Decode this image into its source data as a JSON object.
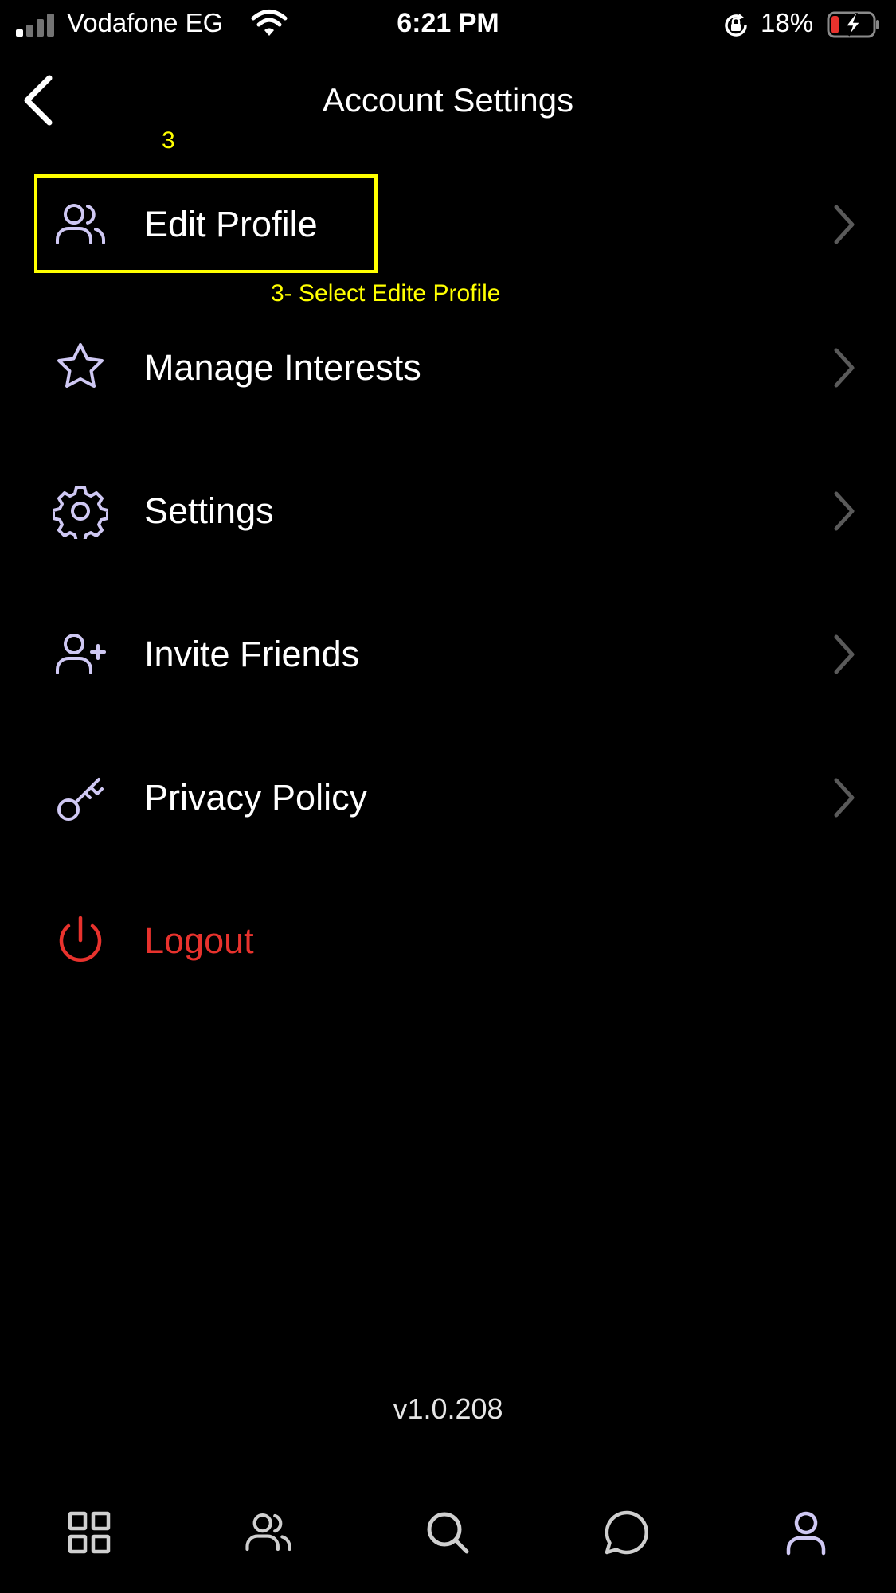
{
  "status_bar": {
    "carrier": "Vodafone EG",
    "time": "6:21 PM",
    "battery_percent": "18%",
    "battery_level": 0.18
  },
  "nav": {
    "title": "Account Settings",
    "back_icon": "chevron-left-icon"
  },
  "annotation": {
    "step_number": "3",
    "caption": "3- Select Edite Profile",
    "color": "#ffff00"
  },
  "menu": {
    "items": [
      {
        "label": "Edit Profile",
        "icon": "users-icon"
      },
      {
        "label": "Manage Interests",
        "icon": "star-icon"
      },
      {
        "label": "Settings",
        "icon": "gear-icon"
      },
      {
        "label": "Invite Friends",
        "icon": "user-plus-icon"
      },
      {
        "label": "Privacy Policy",
        "icon": "key-icon"
      },
      {
        "label": "Logout",
        "icon": "power-icon"
      }
    ]
  },
  "version": "v1.0.208",
  "tab_bar": {
    "tabs": [
      {
        "icon": "grid-icon"
      },
      {
        "icon": "users-icon"
      },
      {
        "icon": "search-icon"
      },
      {
        "icon": "chat-icon"
      },
      {
        "icon": "profile-icon",
        "active": true
      }
    ]
  },
  "colors": {
    "background": "#000000",
    "icon_accent": "#cfc8f3",
    "danger": "#e8322d",
    "chevron": "#5a5a5a",
    "battery_low": "#e8322d"
  }
}
